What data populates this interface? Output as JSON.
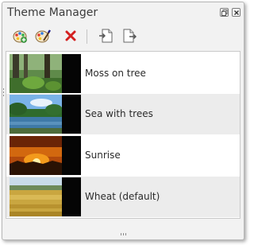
{
  "window": {
    "title": "Theme Manager"
  },
  "titlebar_buttons": [
    {
      "name": "restore-icon"
    },
    {
      "name": "close-icon"
    }
  ],
  "toolbar": {
    "icons": [
      "palette-add-icon",
      "palette-edit-icon",
      "delete-icon",
      "import-icon",
      "export-icon"
    ]
  },
  "themes": [
    {
      "label": "Moss on tree",
      "thumbnail": "forest-moss-thumbnail"
    },
    {
      "label": "Sea with trees",
      "thumbnail": "sea-trees-thumbnail"
    },
    {
      "label": "Sunrise",
      "thumbnail": "sunrise-thumbnail"
    },
    {
      "label": "Wheat (default)",
      "thumbnail": "wheat-field-thumbnail"
    }
  ],
  "colors": {
    "window_bg": "#f2f2f2",
    "list_bg": "#ffffff",
    "row_alt_bg": "#ececec",
    "delete_red": "#d42020"
  }
}
